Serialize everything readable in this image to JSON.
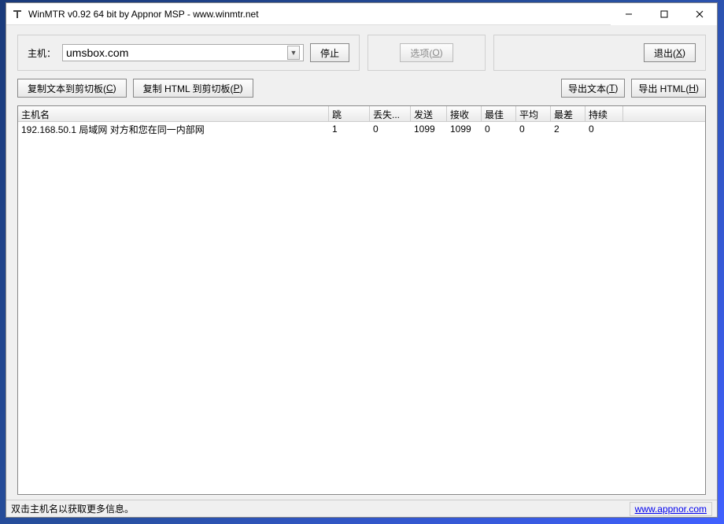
{
  "title": "WinMTR v0.92 64 bit by Appnor MSP - www.winmtr.net",
  "host_label": "主机：",
  "host_value": "umsbox.com",
  "buttons": {
    "stop": "停止",
    "options_pre": "选项(",
    "options_key": "O",
    "options_post": ")",
    "exit_pre": "退出(",
    "exit_key": "X",
    "exit_post": ")",
    "copy_text_pre": "复制文本到剪切板(",
    "copy_text_key": "C",
    "copy_text_post": ")",
    "copy_html_pre": "复制 HTML 到剪切板(",
    "copy_html_key": "P",
    "copy_html_post": ")",
    "export_text_pre": "导出文本(",
    "export_text_key": "T",
    "export_text_post": ")",
    "export_html_pre": "导出 HTML(",
    "export_html_key": "H",
    "export_html_post": ")"
  },
  "columns": {
    "host": "主机名",
    "hop": "跳",
    "loss": "丢失...",
    "sent": "发送",
    "recv": "接收",
    "best": "最佳",
    "avg": "平均",
    "worst": "最差",
    "last": "持续"
  },
  "rows": [
    {
      "host": "192.168.50.1 局域网 对方和您在同一内部网",
      "hop": "1",
      "loss": "0",
      "sent": "1099",
      "recv": "1099",
      "best": "0",
      "avg": "0",
      "worst": "2",
      "last": "0"
    }
  ],
  "status": "双击主机名以获取更多信息。",
  "link": "www.appnor.com"
}
